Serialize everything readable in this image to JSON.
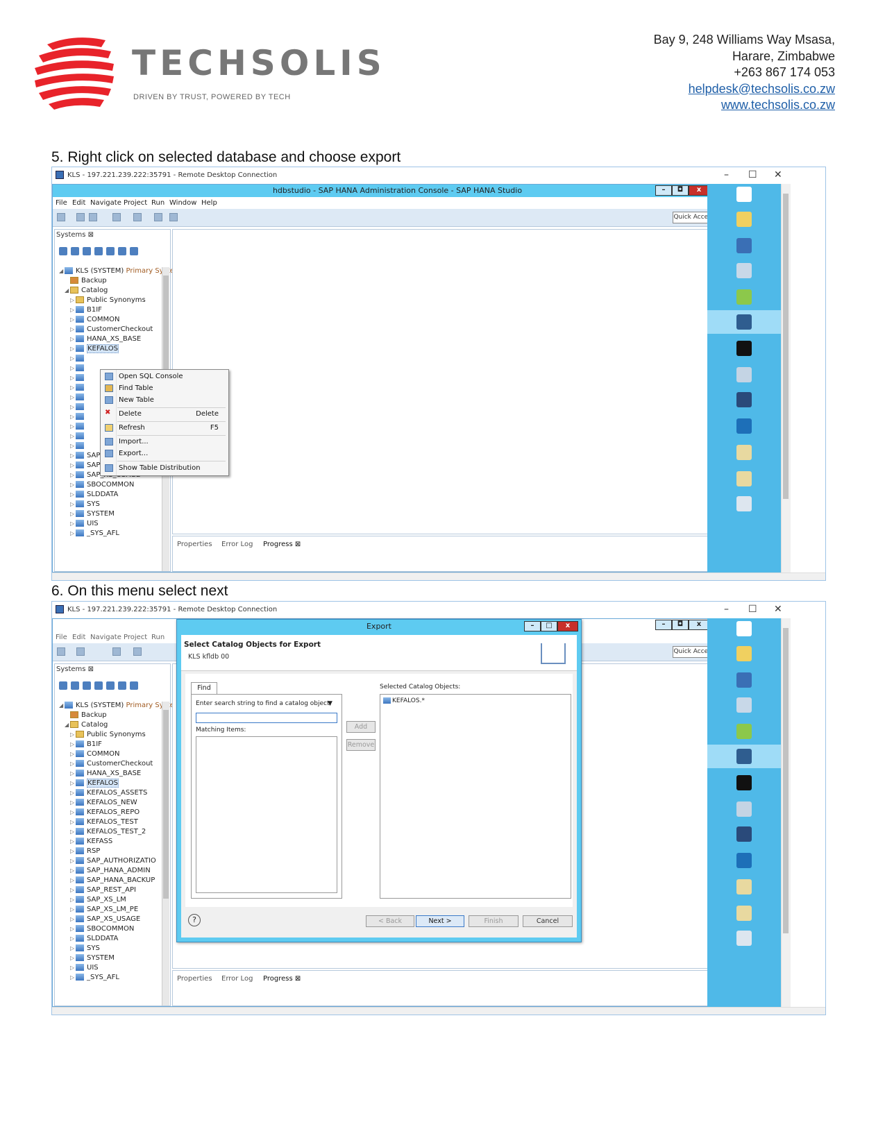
{
  "header": {
    "logo_text": "TECHSOLIS",
    "tagline": "DRIVEN BY TRUST, POWERED BY TECH",
    "address_line1": "Bay 9, 248 Williams Way Msasa,",
    "address_line2": "Harare, Zimbabwe",
    "phone": "+263 867 174 053",
    "email": "helpdesk@techsolis.co.zw",
    "website": "www.techsolis.co.zw",
    "colors": {
      "logo_red": "#e8232a",
      "logo_grey": "#777777",
      "link_blue": "#1f5fa8"
    }
  },
  "steps": [
    {
      "label": "5. Right click on selected database and choose export"
    },
    {
      "label": "6. On this menu select next"
    }
  ],
  "rdp": {
    "title": "KLS - 197.221.239.222:35791 - Remote Desktop Connection",
    "minimize": "–",
    "maximize": "☐",
    "close": "✕"
  },
  "studio": {
    "title": "hdbstudio - SAP HANA Administration Console - SAP HANA Studio",
    "menu": [
      "File",
      "Edit",
      "Navigate",
      "Project",
      "Run",
      "Window",
      "Help"
    ],
    "quick_access": "Quick Access",
    "systems_tab": "Systems ⊠",
    "system_node": "KLS (SYSTEM)",
    "system_suffix": "Primary Syste",
    "backup": "Backup",
    "catalog": "Catalog",
    "bottom_tabs": [
      "Properties",
      "Error Log",
      "Progress ⊠"
    ],
    "colors": {
      "title_bar": "#5ecbf1",
      "taskbar": "#4fb9e8"
    }
  },
  "tree1": [
    "Public Synonyms",
    "B1IF",
    "COMMON",
    "CustomerCheckout",
    "HANA_XS_BASE",
    "KEFALOS",
    "",
    "",
    "",
    "",
    "",
    "",
    "",
    "",
    "",
    "",
    "SAP_XS_LM",
    "SAP_XS_LM_PE",
    "SAP_XS_USAGE",
    "SBOCOMMON",
    "SLDDATA",
    "SYS",
    "SYSTEM",
    "UIS",
    "_SYS_AFL"
  ],
  "tree2": [
    "Public Synonyms",
    "B1IF",
    "COMMON",
    "CustomerCheckout",
    "HANA_XS_BASE",
    "KEFALOS",
    "KEFALOS_ASSETS",
    "KEFALOS_NEW",
    "KEFALOS_REPO",
    "KEFALOS_TEST",
    "KEFALOS_TEST_2",
    "KEFASS",
    "RSP",
    "SAP_AUTHORIZATIO",
    "SAP_HANA_ADMIN",
    "SAP_HANA_BACKUP",
    "SAP_REST_API",
    "SAP_XS_LM",
    "SAP_XS_LM_PE",
    "SAP_XS_USAGE",
    "SBOCOMMON",
    "SLDDATA",
    "SYS",
    "SYSTEM",
    "UIS",
    "_SYS_AFL"
  ],
  "context_menu": {
    "open_sql": "Open SQL Console",
    "find_table": "Find Table",
    "new_table": "New Table",
    "delete": "Delete",
    "delete_key": "Delete",
    "refresh": "Refresh",
    "refresh_key": "F5",
    "import": "Import...",
    "export": "Export...",
    "show_dist": "Show Table Distribution"
  },
  "export_dialog": {
    "title": "Export",
    "heading": "Select Catalog Objects for Export",
    "subheading": "KLS kfldb 00",
    "find_tab": "Find",
    "search_hint": "Enter search string to find a catalog object.",
    "search_value": "",
    "matching_label": "Matching Items:",
    "add": "Add",
    "remove": "Remove",
    "selected_label": "Selected Catalog Objects:",
    "selected_item": "KEFALOS.*",
    "back": "< Back",
    "next": "Next >",
    "finish": "Finish",
    "cancel": "Cancel",
    "help": "?"
  }
}
